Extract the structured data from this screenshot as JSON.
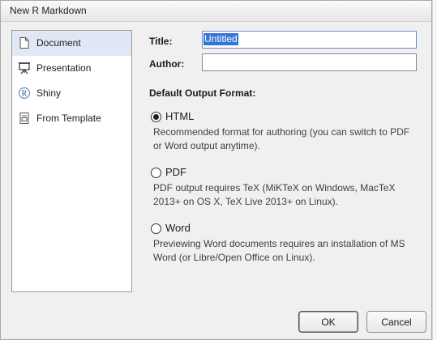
{
  "window": {
    "title": "New R Markdown"
  },
  "sidebar": {
    "items": [
      {
        "label": "Document",
        "icon": "document-icon",
        "selected": true
      },
      {
        "label": "Presentation",
        "icon": "presentation-icon",
        "selected": false
      },
      {
        "label": "Shiny",
        "icon": "shiny-r-icon",
        "selected": false
      },
      {
        "label": "From Template",
        "icon": "template-icon",
        "selected": false
      }
    ]
  },
  "form": {
    "title_label": "Title:",
    "title_value": "Untitled",
    "author_label": "Author:",
    "author_value": ""
  },
  "output": {
    "heading": "Default Output Format:",
    "selected": "HTML",
    "options": [
      {
        "label": "HTML",
        "description_lines": [
          "Recommended format for authoring (you can switch to PDF",
          "or Word output anytime)."
        ]
      },
      {
        "label": "PDF",
        "description_lines": [
          "PDF output requires TeX (MiKTeX on Windows, MacTeX",
          "2013+ on OS X, TeX Live 2013+ on Linux)."
        ]
      },
      {
        "label": "Word",
        "description_lines": [
          "Previewing Word documents requires an installation of MS",
          "Word (or Libre/Open Office on Linux)."
        ]
      }
    ]
  },
  "buttons": {
    "ok": "OK",
    "cancel": "Cancel"
  },
  "colors": {
    "selection": "#3375d6",
    "sidebar_selected": "#dfe8f4",
    "dialog_bg": "#f0f0f0"
  }
}
